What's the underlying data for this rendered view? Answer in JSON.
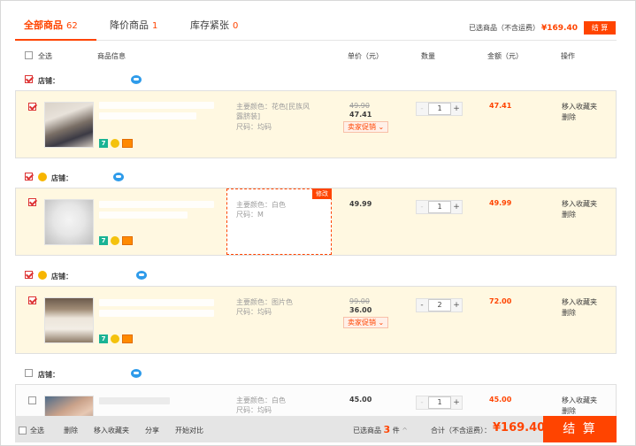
{
  "tabs": [
    {
      "label": "全部商品",
      "count": "62"
    },
    {
      "label": "降价商品",
      "count": "1"
    },
    {
      "label": "库存紧张",
      "count": "0"
    }
  ],
  "summary": {
    "label": "已选商品（不含运费）",
    "price": "¥169.40",
    "checkout": "结 算"
  },
  "columns": {
    "select_all": "全选",
    "info": "商品信息",
    "unit_price": "单价（元）",
    "quantity": "数量",
    "amount": "金额（元）",
    "action": "操作"
  },
  "shops": [
    {
      "label": "店铺：",
      "checked": true,
      "item": {
        "checked": true,
        "sku_color": "主要颜色：花色[民族风露脐装]",
        "sku_size": "尺码：均码",
        "old_price": "49.90",
        "price": "47.41",
        "promo": "卖家促销",
        "qty": "1",
        "amount": "47.41",
        "op_fav": "移入收藏夹",
        "op_del": "删除",
        "badge7": "7"
      }
    },
    {
      "label": "店铺：",
      "checked": true,
      "item": {
        "checked": true,
        "sku_color": "主要颜色：白色",
        "sku_size": "尺码：M",
        "edit": "修改",
        "price": "49.99",
        "qty": "1",
        "amount": "49.99",
        "op_fav": "移入收藏夹",
        "op_del": "删除",
        "badge7": "7"
      }
    },
    {
      "label": "店铺：",
      "checked": true,
      "item": {
        "checked": true,
        "sku_color": "主要颜色：图片色",
        "sku_size": "尺码：均码",
        "old_price": "99.00",
        "price": "36.00",
        "promo": "卖家促销",
        "qty": "2",
        "amount": "72.00",
        "op_fav": "移入收藏夹",
        "op_del": "删除",
        "badge7": "7"
      }
    },
    {
      "label": "店铺：",
      "checked": false,
      "item": {
        "checked": false,
        "sku_color": "主要颜色：白色",
        "sku_size": "尺码：均码",
        "price": "45.00",
        "qty": "1",
        "amount": "45.00",
        "op_fav": "移入收藏夹",
        "op_del": "删除"
      }
    }
  ],
  "footer": {
    "select_all": "全选",
    "delete": "删除",
    "move_fav": "移入收藏夹",
    "share": "分享",
    "compare": "开始对比",
    "selected_label": "已选商品",
    "selected_count": "3",
    "selected_unit": "件",
    "caret": "^",
    "total_label": "合计（不含运费）：",
    "total": "¥169.40",
    "checkout": "结 算"
  },
  "colors": {
    "accent": "#ff4400",
    "row_bg": "#fff8e1",
    "footer_bg": "#e5e5e5"
  }
}
